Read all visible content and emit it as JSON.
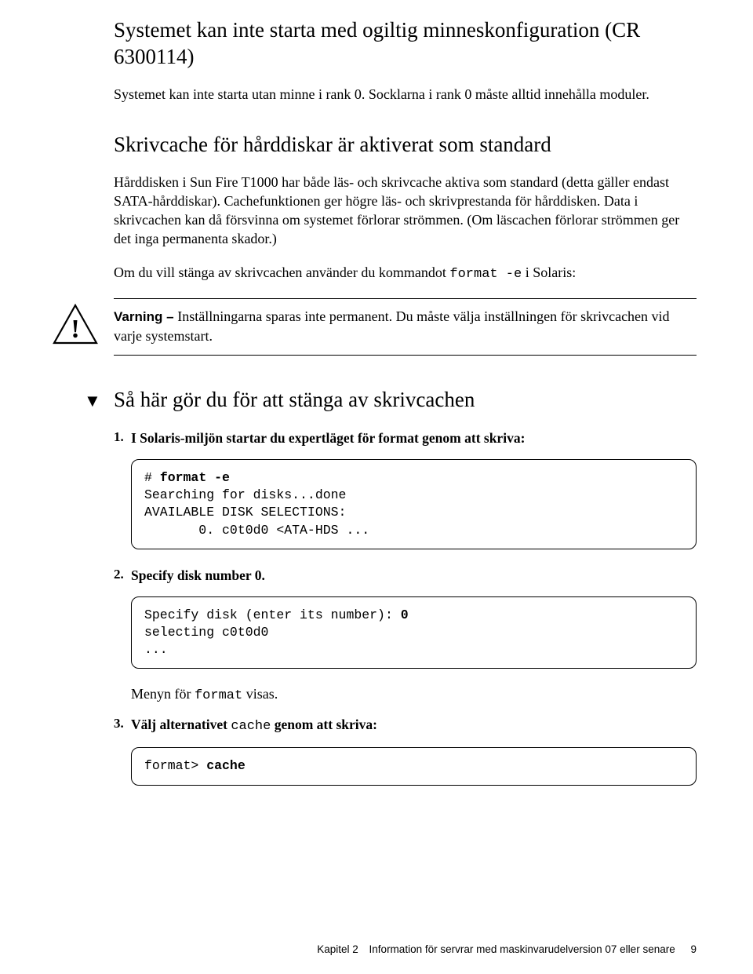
{
  "section1": {
    "heading": "Systemet kan inte starta med ogiltig minneskonfiguration (CR 6300114)",
    "para": "Systemet kan inte starta utan minne i rank 0. Socklarna i rank 0 måste alltid innehålla moduler."
  },
  "section2": {
    "heading": "Skrivcache för hårddiskar är aktiverat som standard",
    "para1": "Hårddisken i Sun Fire T1000 har både läs- och skrivcache aktiva som standard (detta gäller endast SATA-hårddiskar). Cachefunktionen ger högre läs- och skrivprestanda för hårddisken. Data i skrivcachen kan då försvinna om systemet förlorar strömmen. (Om läscachen förlorar strömmen ger det inga permanenta skador.)",
    "para2_pre": "Om du vill stänga av skrivcachen använder du kommandot ",
    "para2_code": "format -e",
    "para2_post": " i Solaris:"
  },
  "caution": {
    "lead": "Varning – ",
    "text": "Inställningarna sparas inte permanent. Du måste välja inställningen för skrivcachen vid varje systemstart."
  },
  "task": {
    "heading": "Så här gör du för att stänga av skrivcachen"
  },
  "steps": {
    "s1": {
      "num": "1.",
      "text": "I Solaris-miljön startar du expertläget för format genom att skriva:",
      "screen_prompt": "# ",
      "screen_cmd": "format -e",
      "screen_out": "Searching for disks...done\nAVAILABLE DISK SELECTIONS:\n       0. c0t0d0 <ATA-HDS ..."
    },
    "s2": {
      "num": "2.",
      "text": "Specify disk number 0.",
      "screen_prompt": "Specify disk (enter its number): ",
      "screen_cmd": "0",
      "screen_out": "selecting c0t0d0\n..."
    },
    "s2b": {
      "plain_pre": "Menyn för ",
      "plain_code": "format",
      "plain_post": " visas."
    },
    "s3": {
      "num": "3.",
      "text_pre": "Välj alternativet ",
      "text_code": "cache",
      "text_post": " genom att skriva:",
      "screen_prompt": "format> ",
      "screen_cmd": "cache"
    }
  },
  "footer": {
    "chapter_label": "Kapitel 2",
    "chapter_title": "Information för servrar med maskinvarudelversion 07 eller senare",
    "page": "9"
  }
}
